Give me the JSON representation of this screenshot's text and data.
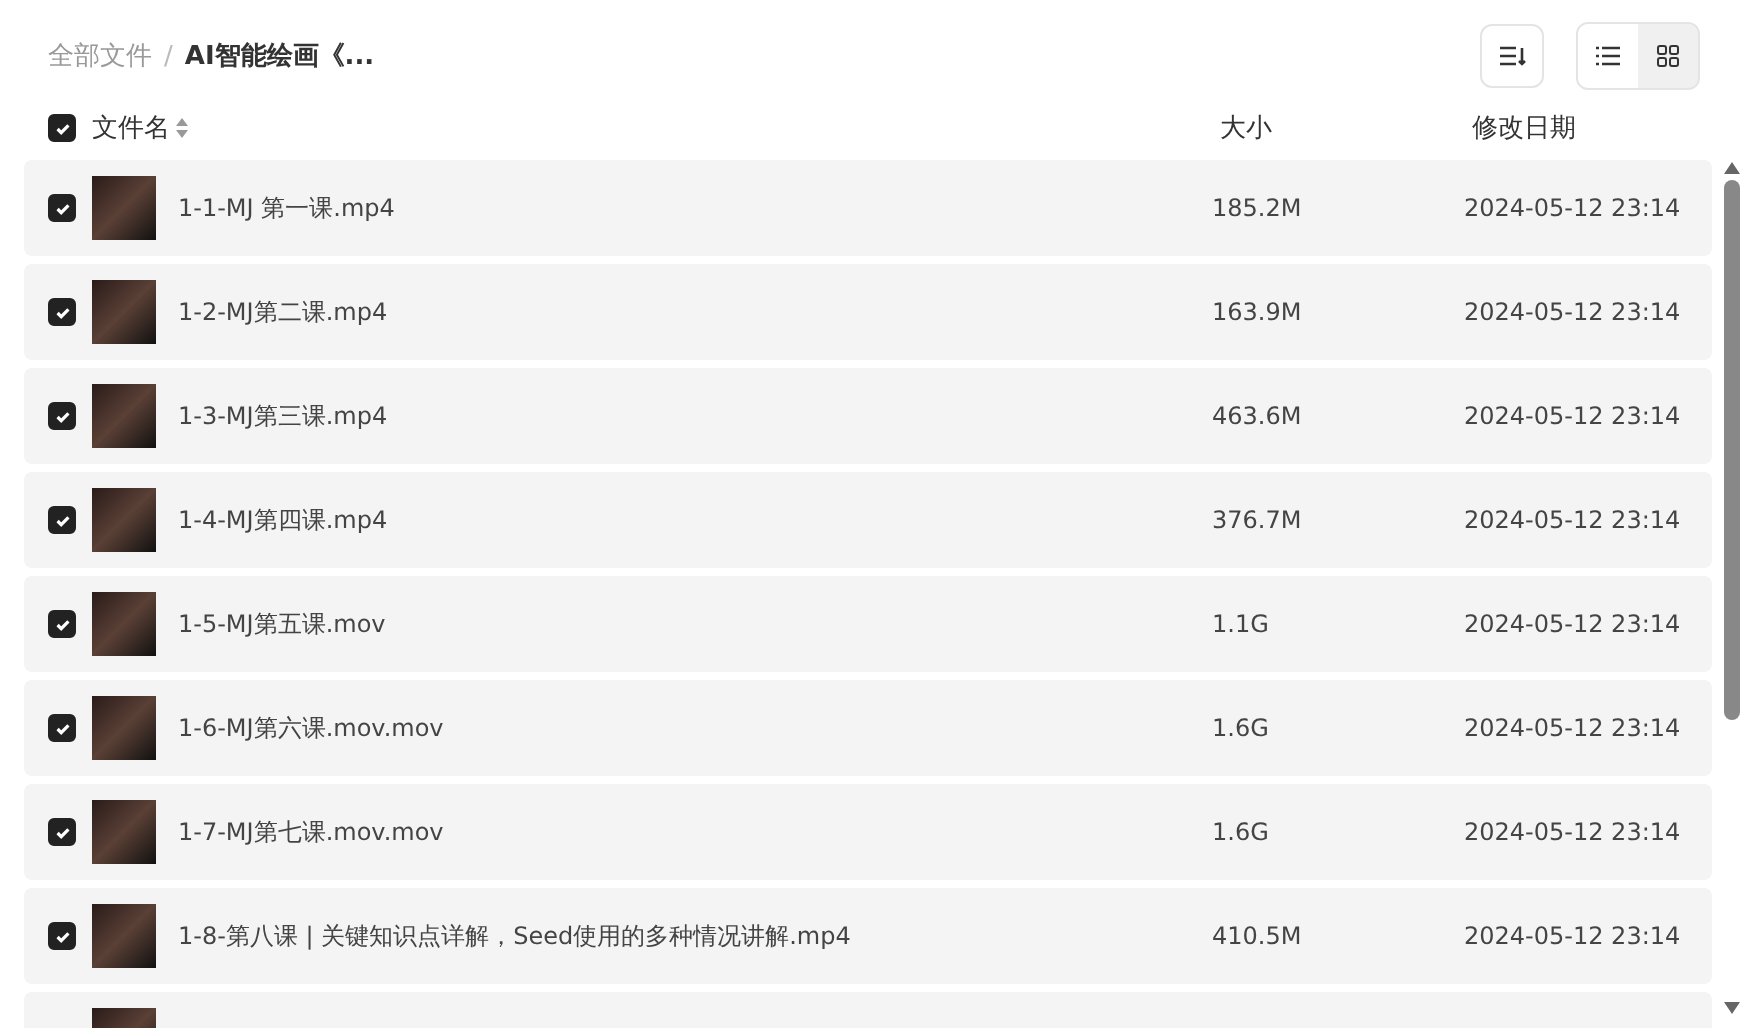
{
  "breadcrumb": {
    "root": "全部文件",
    "separator": "/",
    "current": "AI智能绘画《..."
  },
  "toolbar": {
    "views": [
      {
        "kind": "list",
        "selected": true
      },
      {
        "kind": "grid",
        "selected": false
      }
    ]
  },
  "header": {
    "checked": true,
    "name": "文件名",
    "size": "大小",
    "date": "修改日期"
  },
  "rows": [
    {
      "checked": true,
      "name": "1-1-MJ 第一课.mp4",
      "size": "185.2M",
      "date": "2024-05-12 23:14"
    },
    {
      "checked": true,
      "name": "1-2-MJ第二课.mp4",
      "size": "163.9M",
      "date": "2024-05-12 23:14"
    },
    {
      "checked": true,
      "name": "1-3-MJ第三课.mp4",
      "size": "463.6M",
      "date": "2024-05-12 23:14"
    },
    {
      "checked": true,
      "name": "1-4-MJ第四课.mp4",
      "size": "376.7M",
      "date": "2024-05-12 23:14"
    },
    {
      "checked": true,
      "name": "1-5-MJ第五课.mov",
      "size": "1.1G",
      "date": "2024-05-12 23:14"
    },
    {
      "checked": true,
      "name": "1-6-MJ第六课.mov.mov",
      "size": "1.6G",
      "date": "2024-05-12 23:14"
    },
    {
      "checked": true,
      "name": "1-7-MJ第七课.mov.mov",
      "size": "1.6G",
      "date": "2024-05-12 23:14"
    },
    {
      "checked": true,
      "name": "1-8-第八课 | 关键知识点详解，Seed使用的多种情况讲解.mp4",
      "size": "410.5M",
      "date": "2024-05-12 23:14"
    }
  ],
  "more_rows_below": true
}
